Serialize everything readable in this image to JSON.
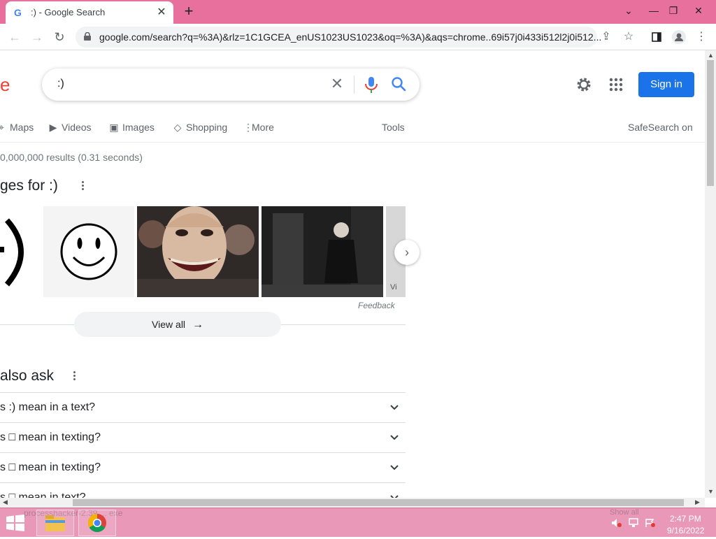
{
  "browser": {
    "tab_title": ":) - Google Search",
    "tab_favicon": "G",
    "url": "google.com/search?q=%3A)&rlz=1C1GCEA_enUS1023US1023&oq=%3A)&aqs=chrome..69i57j0i433i512l2j0i512..."
  },
  "search": {
    "logo_fragment": "e",
    "query": ":)",
    "sign_in": "Sign in"
  },
  "nav_tabs": {
    "maps": "Maps",
    "videos": "Videos",
    "images": "Images",
    "shopping": "Shopping",
    "more": "More",
    "tools": "Tools",
    "safesearch": "SafeSearch on"
  },
  "results": {
    "stats": "0,000,000 results (0.31 seconds)",
    "images_heading": "ges for :)",
    "feedback": "Feedback",
    "view_all": "View all",
    "partial_label": "Vi"
  },
  "paa": {
    "heading": " also ask",
    "questions": [
      "s :) mean in a text?",
      "s □ mean in texting?",
      "s □ mean in texting?",
      "s □ mean in text?"
    ]
  },
  "taskbar": {
    "ghost_text": "processhacker-2.39 ... exe",
    "show_all": "Show all",
    "time": "2:47 PM",
    "date": "9/16/2022"
  },
  "colors": {
    "accent": "#1a73e8",
    "tabstrip": "#e8709c",
    "taskbar": "#e998b8",
    "logo_red": "#ea4335"
  }
}
